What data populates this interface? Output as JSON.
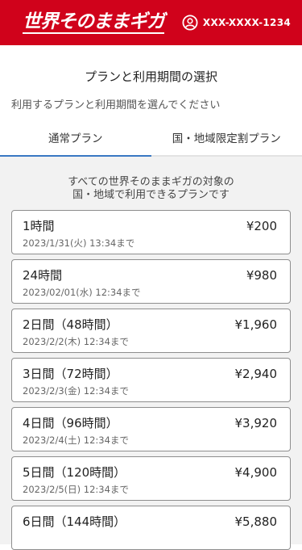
{
  "header": {
    "logo_text": "世界そのままギガ",
    "account_number": "XXX-XXXX-1234",
    "brand_color": "#d0021b"
  },
  "page": {
    "title": "プランと利用期間の選択",
    "subtitle": "利用するプランと利用期間を選んでください"
  },
  "tabs": [
    {
      "label": "通常プラン",
      "active": true
    },
    {
      "label": "国・地域限定割プラン",
      "active": false
    }
  ],
  "notice": {
    "line1": "すべての世界そのままギガの対象の",
    "line2": "国・地域で利用できるプランです"
  },
  "plans": [
    {
      "name": "1時間",
      "price": "¥200",
      "until": "2023/1/31(火) 13:34まで"
    },
    {
      "name": "24時間",
      "price": "¥980",
      "until": "2023/02/01(水) 12:34まで"
    },
    {
      "name": "2日間（48時間）",
      "price": "¥1,960",
      "until": "2023/2/2(木) 12:34まで"
    },
    {
      "name": "3日間（72時間）",
      "price": "¥2,940",
      "until": "2023/2/3(金) 12:34まで"
    },
    {
      "name": "4日間（96時間）",
      "price": "¥3,920",
      "until": "2023/2/4(土) 12:34まで"
    },
    {
      "name": "5日間（120時間）",
      "price": "¥4,900",
      "until": "2023/2/5(日) 12:34まで"
    },
    {
      "name": "6日間（144時間）",
      "price": "¥5,880",
      "until": ""
    }
  ]
}
